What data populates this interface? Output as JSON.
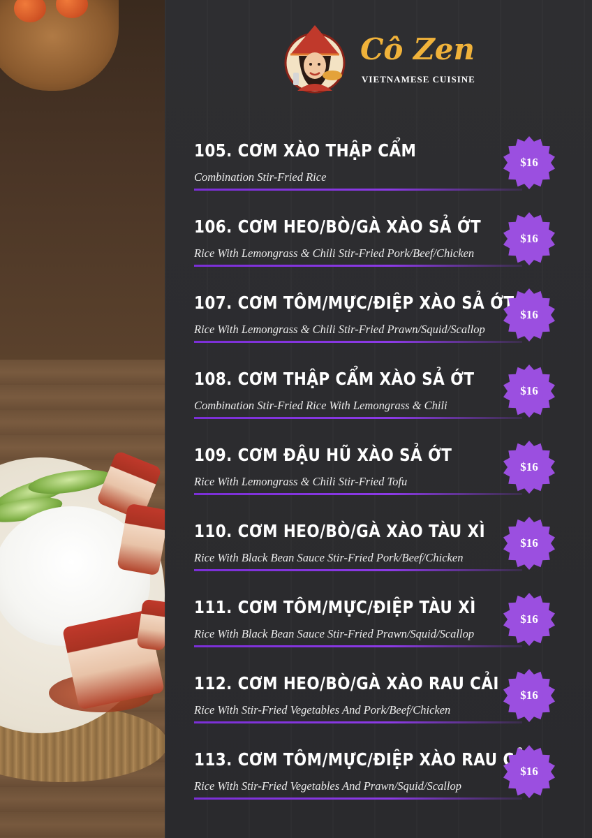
{
  "brand": {
    "name": "Cô Zen",
    "subtitle": "VIETNAMESE CUISINE"
  },
  "colors": {
    "accent_purple": "#8c3ae6",
    "badge_purple": "#9b4fe0",
    "brand_gold": "#f0b23a",
    "panel_bg": "#2b2b2d"
  },
  "menu": {
    "items": [
      {
        "title": "105. CƠM XÀO THẬP CẨM",
        "desc": "Combination Stir-Fried Rice",
        "price": "$16"
      },
      {
        "title": "106. CƠM HEO/BÒ/GÀ XÀO SẢ ỚT",
        "desc": "Rice With Lemongrass & Chili Stir-Fried Pork/Beef/Chicken",
        "price": "$16"
      },
      {
        "title": "107. CƠM TÔM/MỰC/ĐIỆP XÀO SẢ ỚT",
        "desc": "Rice With Lemongrass & Chili Stir-Fried Prawn/Squid/Scallop",
        "price": "$16"
      },
      {
        "title": "108. CƠM THẬP CẨM XÀO SẢ ỚT",
        "desc": "Combination Stir-Fried Rice With Lemongrass & Chili",
        "price": "$16"
      },
      {
        "title": "109. CƠM ĐẬU HŨ XÀO SẢ ỚT",
        "desc": "Rice With Lemongrass & Chili Stir-Fried Tofu",
        "price": "$16"
      },
      {
        "title": "110. CƠM HEO/BÒ/GÀ XÀO TÀU XÌ",
        "desc": "Rice With Black Bean Sauce Stir-Fried Pork/Beef/Chicken",
        "price": "$16"
      },
      {
        "title": "111. CƠM TÔM/MỰC/ĐIỆP TÀU XÌ",
        "desc": "Rice With Black Bean Sauce Stir-Fried Prawn/Squid/Scallop",
        "price": "$16"
      },
      {
        "title": "112. CƠM HEO/BÒ/GÀ XÀO RAU CẢI",
        "desc": "Rice With Stir-Fried Vegetables And Pork/Beef/Chicken",
        "price": "$16"
      },
      {
        "title": "113. CƠM TÔM/MỰC/ĐIỆP XÀO RAU CẢI",
        "desc": "Rice With Stir-Fried Vegetables And Prawn/Squid/Scallop",
        "price": "$16"
      }
    ]
  }
}
